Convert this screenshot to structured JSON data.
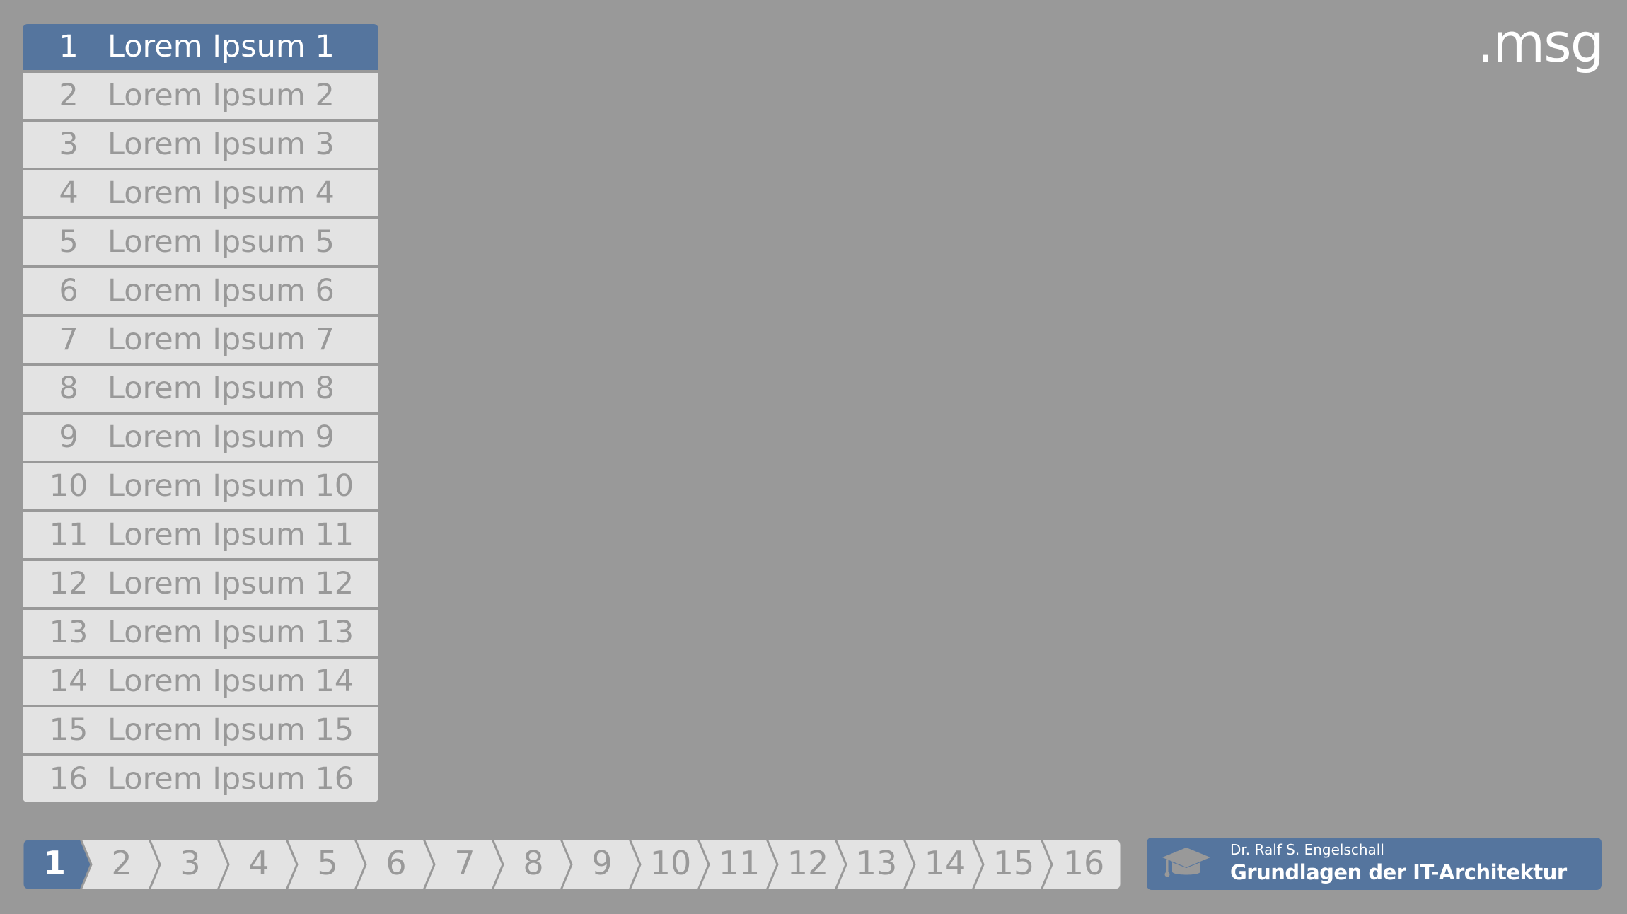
{
  "logo": {
    "text": ".msg"
  },
  "agenda": {
    "items": [
      {
        "number": "1",
        "label": "Lorem Ipsum 1",
        "active": true
      },
      {
        "number": "2",
        "label": "Lorem Ipsum 2",
        "active": false
      },
      {
        "number": "3",
        "label": "Lorem Ipsum 3",
        "active": false
      },
      {
        "number": "4",
        "label": "Lorem Ipsum 4",
        "active": false
      },
      {
        "number": "5",
        "label": "Lorem Ipsum 5",
        "active": false
      },
      {
        "number": "6",
        "label": "Lorem Ipsum 6",
        "active": false
      },
      {
        "number": "7",
        "label": "Lorem Ipsum 7",
        "active": false
      },
      {
        "number": "8",
        "label": "Lorem Ipsum 8",
        "active": false
      },
      {
        "number": "9",
        "label": "Lorem Ipsum 9",
        "active": false
      },
      {
        "number": "10",
        "label": "Lorem Ipsum 10",
        "active": false
      },
      {
        "number": "11",
        "label": "Lorem Ipsum 11",
        "active": false
      },
      {
        "number": "12",
        "label": "Lorem Ipsum 12",
        "active": false
      },
      {
        "number": "13",
        "label": "Lorem Ipsum 13",
        "active": false
      },
      {
        "number": "14",
        "label": "Lorem Ipsum 14",
        "active": false
      },
      {
        "number": "15",
        "label": "Lorem Ipsum 15",
        "active": false
      },
      {
        "number": "16",
        "label": "Lorem Ipsum 16",
        "active": false
      }
    ]
  },
  "slide_nav": {
    "current": "1",
    "tabs": [
      "1",
      "2",
      "3",
      "4",
      "5",
      "6",
      "7",
      "8",
      "9",
      "10",
      "11",
      "12",
      "13",
      "14",
      "15",
      "16"
    ]
  },
  "course": {
    "icon": "graduation-cap-icon",
    "author": "Dr. Ralf S. Engelschall",
    "title": "Grundlagen der IT-Architektur"
  },
  "colors": {
    "background": "#999999",
    "accent": "#55759e",
    "inactive_fill": "#e3e3e3",
    "inactive_text": "#999999",
    "active_text": "#ffffff"
  }
}
